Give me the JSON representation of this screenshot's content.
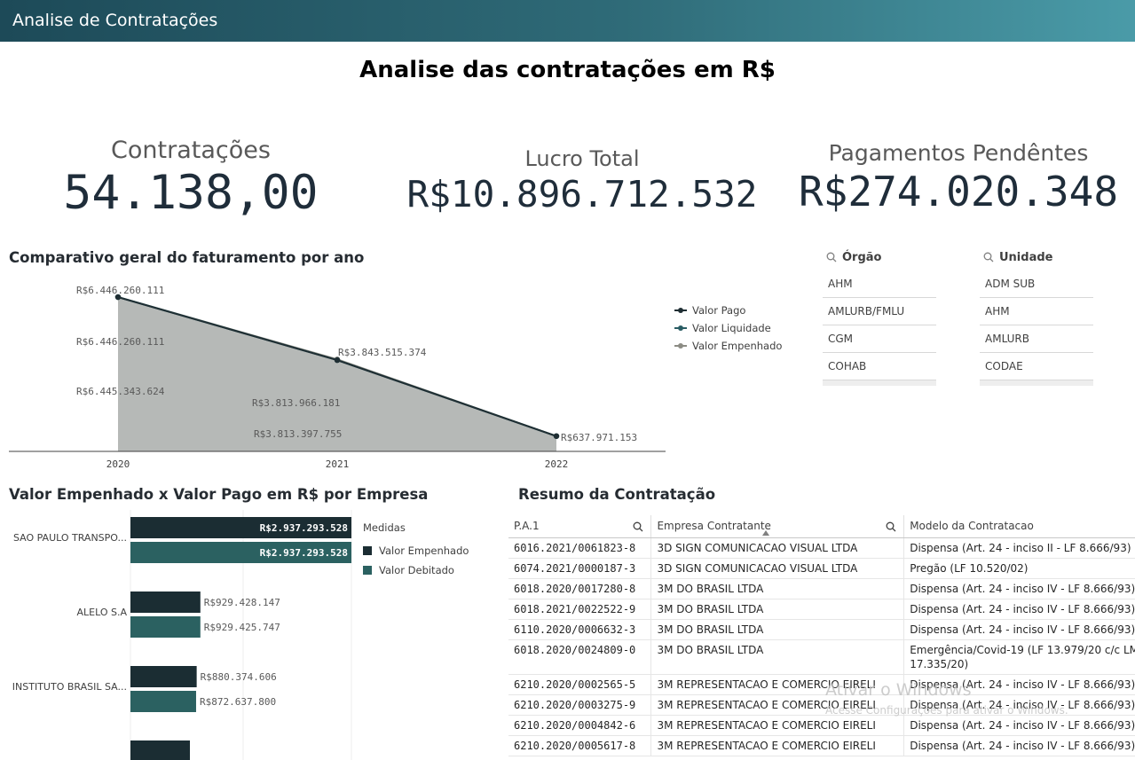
{
  "app": {
    "title": "Analise de Contratações"
  },
  "page": {
    "title": "Analise das contratações em R$"
  },
  "kpis": {
    "contratacoes": {
      "label": "Contratações",
      "value": "54.138,00"
    },
    "lucro": {
      "label": "Lucro Total",
      "value": "R$10.896.712.532"
    },
    "pendentes": {
      "label": "Pagamentos Pendêntes",
      "value": "R$274.020.348"
    }
  },
  "colors": {
    "pago": "#1f2e33",
    "liquidado": "#2a5d64",
    "empenhado": "#8c8c84",
    "bar_empenhado": "#1b2d33",
    "bar_debitado": "#2b6161"
  },
  "line_chart": {
    "title": "Comparativo geral do faturamento por ano",
    "legend": [
      "Valor Pago",
      "Valor Liquidade",
      "Valor Empenhado"
    ]
  },
  "filters": {
    "orgao": {
      "label": "Órgão",
      "items": [
        "AHM",
        "AMLURB/FMLU",
        "CGM",
        "COHAB"
      ]
    },
    "unidade": {
      "label": "Unidade",
      "items": [
        "ADM SUB",
        "AHM",
        "AMLURB",
        "CODAE"
      ]
    }
  },
  "bar_chart": {
    "title": "Valor Empenhado x Valor Pago em R$ por Empresa",
    "legend_title": "Medidas",
    "legend": [
      "Valor Empenhado",
      "Valor Debitado"
    ]
  },
  "table": {
    "title": "Resumo da Contratação",
    "columns": [
      "P.A.1",
      "Empresa Contratante",
      "Modelo da Contratacao"
    ],
    "rows": [
      [
        "6016.2021/0061823-8",
        "3D SIGN COMUNICACAO VISUAL LTDA",
        "Dispensa (Art. 24 - inciso II - LF 8.666/93)"
      ],
      [
        "6074.2021/0000187-3",
        "3D SIGN COMUNICACAO VISUAL LTDA",
        "Pregão (LF 10.520/02)"
      ],
      [
        "6018.2020/0017280-8",
        "3M DO BRASIL LTDA",
        "Dispensa (Art. 24 - inciso IV - LF 8.666/93)"
      ],
      [
        "6018.2021/0022522-9",
        "3M DO BRASIL LTDA",
        "Dispensa (Art. 24 - inciso IV - LF 8.666/93)"
      ],
      [
        "6110.2020/0006632-3",
        "3M DO BRASIL LTDA",
        "Dispensa (Art. 24 - inciso IV - LF 8.666/93)"
      ],
      [
        "6018.2020/0024809-0",
        "3M DO BRASIL LTDA",
        "Emergência/Covid-19 (LF 13.979/20 c/c LM 17.335/20)"
      ],
      [
        "6210.2020/0002565-5",
        "3M REPRESENTACAO E COMERCIO EIRELI",
        "Dispensa (Art. 24 - inciso IV - LF 8.666/93)"
      ],
      [
        "6210.2020/0003275-9",
        "3M REPRESENTACAO E COMERCIO EIRELI",
        "Dispensa (Art. 24 - inciso IV - LF 8.666/93)"
      ],
      [
        "6210.2020/0004842-6",
        "3M REPRESENTACAO E COMERCIO EIRELI",
        "Dispensa (Art. 24 - inciso IV - LF 8.666/93)"
      ],
      [
        "6210.2020/0005617-8",
        "3M REPRESENTACAO E COMERCIO EIRELI",
        "Dispensa (Art. 24 - inciso IV - LF 8.666/93)"
      ]
    ]
  },
  "watermark": {
    "line1": "Ativar o Windows",
    "line2": "Acesse Configurações para ativar o Windows."
  },
  "chart_data": [
    {
      "type": "area",
      "title": "Comparativo geral do faturamento por ano",
      "x": [
        "2020",
        "2021",
        "2022"
      ],
      "series": [
        {
          "name": "Valor Empenhado",
          "values": [
            6446260111,
            3843515374,
            637971153
          ],
          "labels": [
            "R$6.446.260.111",
            "R$3.843.515.374",
            "R$637.971.153"
          ]
        },
        {
          "name": "Valor Liquidade",
          "values": [
            6446260111,
            3813966181,
            637971153
          ],
          "labels": [
            "R$6.446.260.111",
            "R$3.813.966.181",
            ""
          ]
        },
        {
          "name": "Valor Pago",
          "values": [
            6445343624,
            3813397755,
            637971153
          ],
          "labels": [
            "R$6.445.343.624",
            "R$3.813.397.755",
            ""
          ]
        }
      ],
      "legend": "right"
    },
    {
      "type": "bar",
      "title": "Valor Empenhado x Valor Pago em R$ por Empresa",
      "orientation": "horizontal",
      "categories": [
        "SAO PAULO TRANSPO...",
        "ALELO S.A",
        "INSTITUTO BRASIL SA..."
      ],
      "series": [
        {
          "name": "Valor Empenhado",
          "values": [
            2937293528,
            929428147,
            880374606
          ],
          "labels": [
            "R$2.937.293.528",
            "R$929.428.147",
            "R$880.374.606"
          ]
        },
        {
          "name": "Valor Debitado",
          "values": [
            2937293528,
            929425747,
            872637800
          ],
          "labels": [
            "R$2.937.293.528",
            "R$929.425.747",
            "R$872.637.800"
          ]
        }
      ],
      "legend": "right"
    }
  ]
}
